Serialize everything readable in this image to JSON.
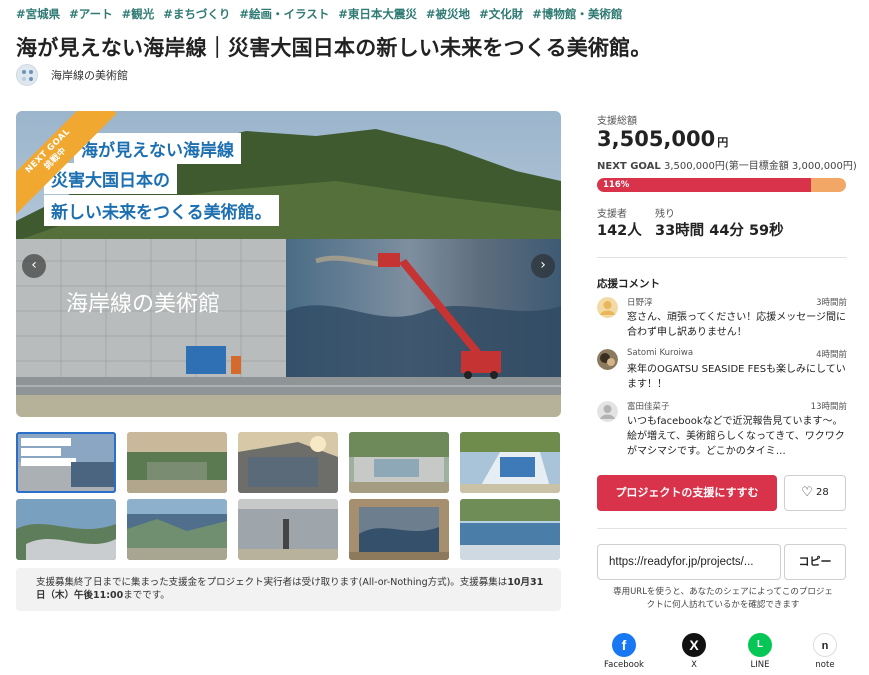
{
  "tags": [
    "#宮城県",
    "#アート",
    "#観光",
    "#まちづくり",
    "#絵画・イラスト",
    "#東日本大震災",
    "#被災地",
    "#文化財",
    "#博物館・美術館"
  ],
  "title": "海が見えない海岸線｜災害大国日本の新しい未来をつくる美術館。",
  "owner": {
    "name": "海岸線の美術館"
  },
  "hero": {
    "ribbon_line1": "NEXT GOAL",
    "ribbon_line2": "挑戦中",
    "caption1": "海が見えない海岸線",
    "caption2": "災害大国日本の",
    "caption3": "新しい未来をつくる美術館。",
    "wall_text": "海岸線の美術館",
    "prev_icon": "chevron-left-icon",
    "next_icon": "chevron-right-icon"
  },
  "notice": {
    "text": "支援募集終了日までに集まった支援金をプロジェクト実行者は受け取ります(All-or-Nothing方式)。支援募集は",
    "deadline": "10月31日（木）午後11:00",
    "suffix": "までです。"
  },
  "funding": {
    "total_label": "支援総額",
    "total": "3,505,000",
    "currency": "円",
    "next_goal_label": "NEXT GOAL",
    "next_goal_text": "3,500,000円(第一目標金額 3,000,000円)",
    "progress_label": "116%",
    "progress_fraction": 0.86,
    "supporters_label": "支援者",
    "supporters": "142人",
    "remaining_label": "残り",
    "remaining": "33時間 44分 59秒"
  },
  "comments": {
    "title": "応援コメント",
    "items": [
      {
        "name": "日野淳",
        "time": "3時間前",
        "text": "窓さん、頑張ってください！応援メッセージ間に合わず申し訳ありません！"
      },
      {
        "name": "Satomi Kuroiwa",
        "time": "4時間前",
        "text": "来年のOGATSU SEASIDE FESも楽しみにしています！！"
      },
      {
        "name": "富田佳菜子",
        "time": "13時間前",
        "text": "いつもfacebookなどで近況報告見ています〜。絵が増えて、美術館らしくなってきて、ワクワクがマシマシです。どこかのタイミ…"
      }
    ]
  },
  "actions": {
    "support_label": "プロジェクトの支援にすすむ",
    "like_count": "28",
    "share_url": "https://readyfor.jp/projects/...",
    "copy_label": "コピー",
    "share_note": "専用URLを使うと、あなたのシェアによってこのプロジェクトに何人訪れているかを確認できます"
  },
  "social": [
    {
      "name": "Facebook",
      "icon": "facebook-icon",
      "glyph": "f",
      "color": "#1877f2"
    },
    {
      "name": "X",
      "icon": "x-icon",
      "glyph": "X",
      "color": "#111111"
    },
    {
      "name": "LINE",
      "icon": "line-icon",
      "glyph": "L",
      "color": "#06c755"
    },
    {
      "name": "note",
      "icon": "note-icon",
      "glyph": "n",
      "color": "#ffffff"
    }
  ],
  "colors": {
    "accent": "#d9334b",
    "bar_bg": "#f3a767",
    "tag": "#2f7a73",
    "caption": "#1c6fb0"
  }
}
